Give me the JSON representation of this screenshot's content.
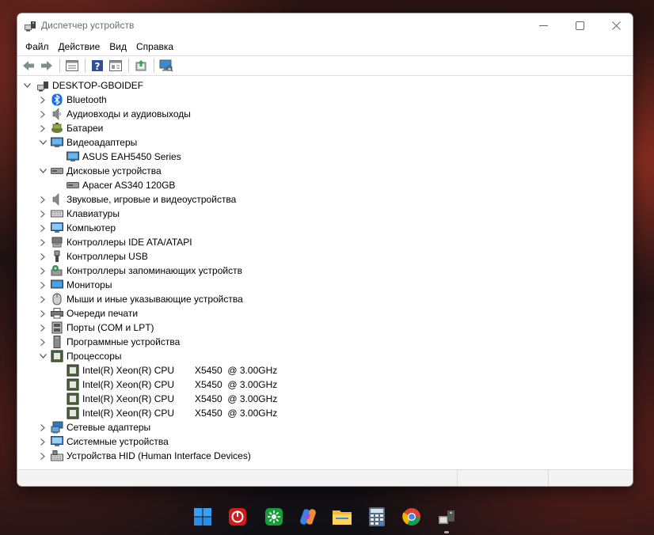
{
  "window": {
    "title": "Диспетчер устройств",
    "controls": {
      "minimize": "—",
      "maximize": "☐",
      "close": "✕"
    }
  },
  "menu": [
    "Файл",
    "Действие",
    "Вид",
    "Справка"
  ],
  "toolbar": [
    "back-icon",
    "forward-icon",
    "properties-icon",
    "help-icon",
    "view-icon",
    "update-driver-icon",
    "scan-hardware-icon"
  ],
  "tree": {
    "root": "DESKTOP-GBOIDEF",
    "items": [
      {
        "label": "Bluetooth",
        "icon": "bluetooth-icon",
        "expanded": false
      },
      {
        "label": "Аудиовходы и аудиовыходы",
        "icon": "speaker-icon",
        "expanded": false
      },
      {
        "label": "Батареи",
        "icon": "battery-icon",
        "expanded": false
      },
      {
        "label": "Видеоадаптеры",
        "icon": "display-adapter-icon",
        "expanded": true,
        "children": [
          "ASUS EAH5450 Series"
        ]
      },
      {
        "label": "Дисковые устройства",
        "icon": "disk-drive-icon",
        "expanded": true,
        "children": [
          "Apacer AS340 120GB"
        ]
      },
      {
        "label": "Звуковые, игровые и видеоустройства",
        "icon": "sound-icon",
        "expanded": false
      },
      {
        "label": "Клавиатуры",
        "icon": "keyboard-icon",
        "expanded": false
      },
      {
        "label": "Компьютер",
        "icon": "computer-icon",
        "expanded": false
      },
      {
        "label": "Контроллеры IDE ATA/ATAPI",
        "icon": "ide-controller-icon",
        "expanded": false
      },
      {
        "label": "Контроллеры USB",
        "icon": "usb-icon",
        "expanded": false
      },
      {
        "label": "Контроллеры запоминающих устройств",
        "icon": "storage-controller-icon",
        "expanded": false
      },
      {
        "label": "Мониторы",
        "icon": "monitor-icon",
        "expanded": false
      },
      {
        "label": "Мыши и иные указывающие устройства",
        "icon": "mouse-icon",
        "expanded": false
      },
      {
        "label": "Очереди печати",
        "icon": "printer-icon",
        "expanded": false
      },
      {
        "label": "Порты (COM и LPT)",
        "icon": "port-icon",
        "expanded": false
      },
      {
        "label": "Программные устройства",
        "icon": "software-device-icon",
        "expanded": false
      },
      {
        "label": "Процессоры",
        "icon": "processor-icon",
        "expanded": true,
        "cpus": [
          {
            "name": "Intel(R) Xeon(R) CPU",
            "model": "X5450  @ 3.00GHz"
          },
          {
            "name": "Intel(R) Xeon(R) CPU",
            "model": "X5450  @ 3.00GHz"
          },
          {
            "name": "Intel(R) Xeon(R) CPU",
            "model": "X5450  @ 3.00GHz"
          },
          {
            "name": "Intel(R) Xeon(R) CPU",
            "model": "X5450  @ 3.00GHz"
          }
        ]
      },
      {
        "label": "Сетевые адаптеры",
        "icon": "network-adapter-icon",
        "expanded": false
      },
      {
        "label": "Системные устройства",
        "icon": "system-device-icon",
        "expanded": false
      },
      {
        "label": "Устройства HID (Human Interface Devices)",
        "icon": "hid-icon",
        "expanded": false
      }
    ]
  },
  "taskbar": {
    "apps": [
      "windows-start-icon",
      "opera-icon",
      "torrent-icon",
      "copilot-icon",
      "file-explorer-icon",
      "calculator-icon",
      "chrome-icon",
      "device-manager-icon"
    ]
  },
  "colors": {
    "accent": "#0067c0",
    "chevron": "#555555"
  }
}
